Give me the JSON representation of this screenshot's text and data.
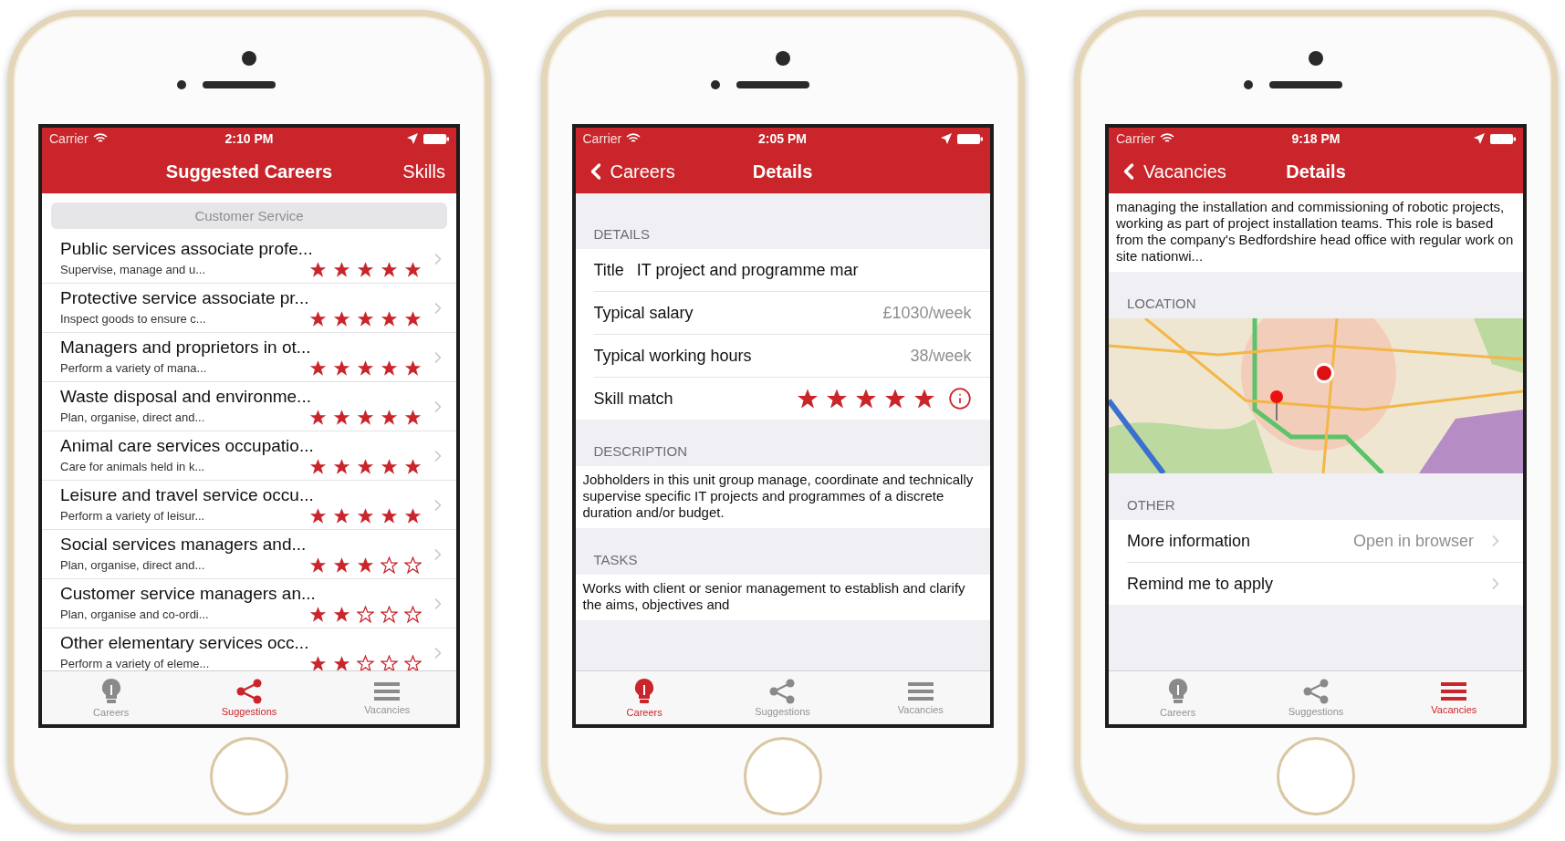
{
  "phones": [
    {
      "status": {
        "carrier": "Carrier",
        "time": "2:10 PM"
      },
      "nav": {
        "title": "Suggested Careers",
        "action": "Skills"
      },
      "content": [
        {
          "kind": "segment",
          "label": "Customer Service"
        },
        {
          "kind": "career_list",
          "items": [
            {
              "title": "Public services associate profe...",
              "summary": "Supervise, manage and u...",
              "stars": 5
            },
            {
              "title": "Protective service associate pr...",
              "summary": "Inspect goods to ensure c...",
              "stars": 5
            },
            {
              "title": "Managers and proprietors in ot...",
              "summary": "Perform a variety of mana...",
              "stars": 5
            },
            {
              "title": "Waste disposal and environme...",
              "summary": "Plan, organise, direct and...",
              "stars": 5
            },
            {
              "title": "Animal care services occupatio...",
              "summary": "Care for animals held in k...",
              "stars": 5
            },
            {
              "title": "Leisure and travel service occu...",
              "summary": "Perform a variety of leisur...",
              "stars": 5
            },
            {
              "title": "Social services managers and...",
              "summary": "Plan, organise, direct and...",
              "stars": 3
            },
            {
              "title": "Customer service managers an...",
              "summary": "Plan, organise and co-ordi...",
              "stars": 2
            },
            {
              "title": "Other elementary services occ...",
              "summary": "Perform a variety of eleme...",
              "stars": 2
            }
          ]
        }
      ],
      "tabs": [
        {
          "kind": "bulb",
          "label": "Careers",
          "selected": false
        },
        {
          "kind": "share",
          "label": "Suggestions",
          "selected": true
        },
        {
          "kind": "list",
          "label": "Vacancies",
          "selected": false
        }
      ]
    },
    {
      "status": {
        "carrier": "Carrier",
        "time": "2:05 PM"
      },
      "nav": {
        "back": "Careers",
        "title": "Details"
      },
      "content": [
        {
          "kind": "header",
          "text": "DETAILS"
        },
        {
          "kind": "rows",
          "rows": [
            {
              "kind": "field",
              "label": "Title",
              "value": "IT project and programme mar"
            },
            {
              "kind": "value",
              "label": "Typical salary",
              "value": "£1030/week"
            },
            {
              "kind": "value",
              "label": "Typical working hours",
              "value": "38/week"
            },
            {
              "kind": "stars",
              "label": "Skill match",
              "stars": 5
            }
          ]
        },
        {
          "kind": "header",
          "text": "DESCRIPTION"
        },
        {
          "kind": "paragraph",
          "text": "Jobholders in this unit group manage, coordinate and technically supervise specific IT projects and programmes of a discrete duration and/or budget."
        },
        {
          "kind": "header",
          "text": "TASKS"
        },
        {
          "kind": "paragraph",
          "text": "Works with client or senior management to establish and clarify the aims, objectives and"
        }
      ],
      "tabs": [
        {
          "kind": "bulb",
          "label": "Careers",
          "selected": true
        },
        {
          "kind": "share",
          "label": "Suggestions",
          "selected": false
        },
        {
          "kind": "list",
          "label": "Vacancies",
          "selected": false
        }
      ]
    },
    {
      "status": {
        "carrier": "Carrier",
        "time": "9:18 PM"
      },
      "nav": {
        "back": "Vacancies",
        "title": "Details"
      },
      "content": [
        {
          "kind": "paragraph",
          "text": "managing the installation and commissioning of robotic projects, working as part of project installation teams. This role is based from the company's Bedfordshire head office with regular work on site nationwi..."
        },
        {
          "kind": "header",
          "text": "LOCATION"
        },
        {
          "kind": "map"
        },
        {
          "kind": "header",
          "text": "OTHER"
        },
        {
          "kind": "rows",
          "rows": [
            {
              "kind": "link",
              "label": "More information",
              "value": "Open in browser"
            },
            {
              "kind": "link",
              "label": "Remind me to apply"
            }
          ]
        }
      ],
      "tabs": [
        {
          "kind": "bulb",
          "label": "Careers",
          "selected": false
        },
        {
          "kind": "share",
          "label": "Suggestions",
          "selected": false
        },
        {
          "kind": "list",
          "label": "Vacancies",
          "selected": true
        }
      ]
    }
  ]
}
